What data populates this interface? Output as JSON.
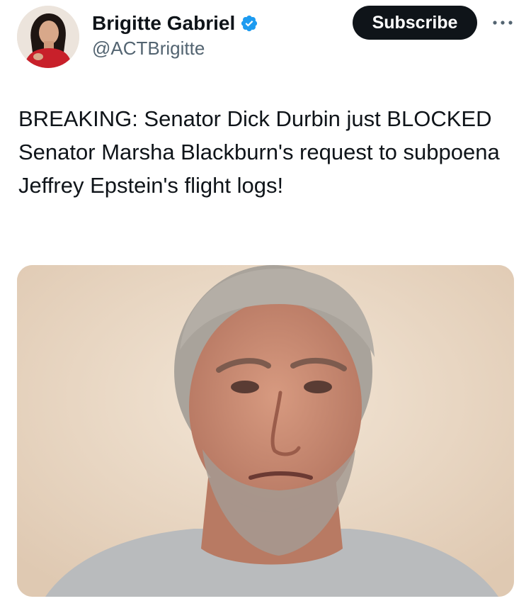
{
  "author": {
    "name": "Brigitte Gabriel",
    "handle": "@ACTBrigitte",
    "verified": true,
    "avatar_icon": "profile-photo"
  },
  "actions": {
    "subscribe_label": "Subscribe",
    "more_icon": "more-horizontal-icon"
  },
  "tweet": {
    "text": "BREAKING: Senator Dick Durbin just BLOCKED Senator Marsha Blackburn's request to subpoena Jeffrey Epstein's flight logs!"
  },
  "media": {
    "type": "photo",
    "subject": "portrait photo"
  },
  "colors": {
    "text": "#0f1419",
    "secondary_text": "#536471",
    "verified_blue": "#1d9bf0",
    "subscribe_bg": "#0f1419",
    "subscribe_text": "#ffffff"
  }
}
